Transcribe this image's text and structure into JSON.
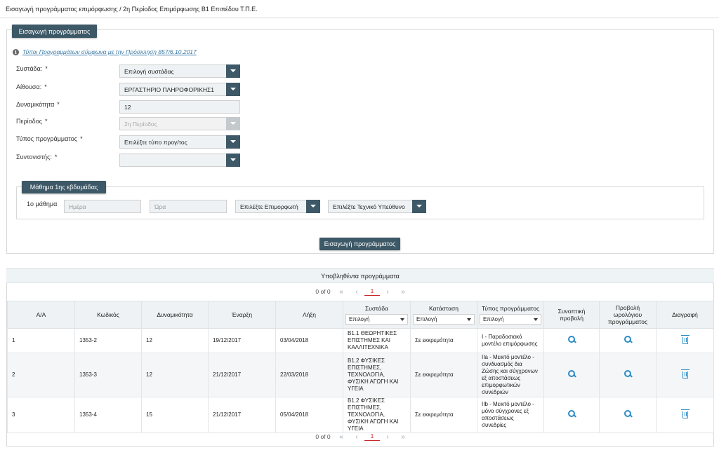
{
  "header": {
    "title": "Εισαγωγή προγράμματος επιμόρφωσης / 2η Περίοδος Επιμόρφωσης Β1 Επιπέδου Τ.Π.Ε."
  },
  "form": {
    "tab_label": "Εισαγωγή προγράμματος",
    "info_link": "Τύποι Προγραμμάτων σύμφωνα με την Πρόσκληση 857/6.10.2017",
    "required_mark": "*",
    "fields": {
      "systada": {
        "label": "Συστάδα:",
        "value": "Επιλογή συστάδας"
      },
      "aithousa": {
        "label": "Αίθουσα:",
        "value": "ΕΡΓΑΣΤΗΡΙΟ ΠΛΗΡΟΦΟΡΙΚΗΣ1"
      },
      "dynamikotita": {
        "label": "Δυναμικότητα",
        "value": "12"
      },
      "periodos": {
        "label": "Περίοδος",
        "value": "2η Περίοδος"
      },
      "typos": {
        "label": "Τύπος προγράμματος",
        "value": "Επιλέξτε τύπο προγ/τος"
      },
      "syntonistis": {
        "label": "Συντονιστής:",
        "value": ""
      }
    },
    "week": {
      "legend": "Μάθημα 1ης εβδομάδας",
      "lesson_label": "1ο μάθημα",
      "day_placeholder": "Ημέρα",
      "time_placeholder": "Ώρα",
      "trainer_value": "Επιλέξτε Επιμορφωτή",
      "tech_value": "Επιλέξτε Τεχνικό Υπεύθυνο"
    },
    "submit_label": "Εισαγωγή προγράμματος"
  },
  "submitted": {
    "title": "Υποβληθέντα προγράμματα",
    "pager": {
      "count": "0 of 0",
      "current_page": "1"
    },
    "columns": {
      "aa": "Α/Α",
      "code": "Κωδικός",
      "capacity": "Δυναμικότητα",
      "start": "Έναρξη",
      "end": "Λήξη",
      "cluster": "Συστάδα",
      "status": "Κατάσταση",
      "type": "Τύπος προγράμματος",
      "summary": "Συνοπτική προβολή",
      "schedule": "Προβολή ωρολόγιου προγράμματος",
      "delete": "Διαγραφή",
      "filter_placeholder": "Επιλογή"
    },
    "rows": [
      {
        "aa": "1",
        "code": "1353-2",
        "capacity": "12",
        "start": "19/12/2017",
        "end": "03/04/2018",
        "cluster": "Β1.1 ΘΕΩΡΗΤΙΚΕΣ ΕΠΙΣΤΗΜΕΣ ΚΑΙ ΚΑΛΛΙΤΕΧΝΙΚΑ",
        "status": "Σε εκκρεμότητα",
        "type": "I - Παραδοσιακό μοντέλο επιμόρφωσης"
      },
      {
        "aa": "2",
        "code": "1353-3",
        "capacity": "12",
        "start": "21/12/2017",
        "end": "22/03/2018",
        "cluster": "Β1.2 ΦΥΣΙΚΕΣ ΕΠΙΣΤΗΜΕΣ, ΤΕΧΝΟΛΟΓΙΑ, ΦΥΣΙΚΗ ΑΓΩΓΗ ΚΑΙ ΥΓΕΙΑ",
        "status": "Σε εκκρεμότητα",
        "type": "IIa - Μεικτό μοντέλο - συνδυασμός δια Ζώσης και σύγχρονων εξ αποστάσεως επιμορφωτικών συνεδριών"
      },
      {
        "aa": "3",
        "code": "1353-4",
        "capacity": "15",
        "start": "21/12/2017",
        "end": "05/04/2018",
        "cluster": "Β1.2 ΦΥΣΙΚΕΣ ΕΠΙΣΤΗΜΕΣ, ΤΕΧΝΟΛΟΓΙΑ, ΦΥΣΙΚΗ ΑΓΩΓΗ ΚΑΙ ΥΓΕΙΑ",
        "status": "Σε εκκρεμότητα",
        "type": "IIb - Μεικτό μοντέλο - μόνο σύγχρονες εξ αποστάσεως συνεδρίες"
      }
    ]
  },
  "colors": {
    "accent": "#3d5866",
    "icon": "#2a8cc7",
    "page_active": "#c62828",
    "panel_header": "#eef3f6"
  },
  "icons": [
    "info-icon",
    "chevron-down-icon",
    "search-icon",
    "trash-icon",
    "first-page-icon",
    "prev-page-icon",
    "next-page-icon",
    "last-page-icon"
  ]
}
